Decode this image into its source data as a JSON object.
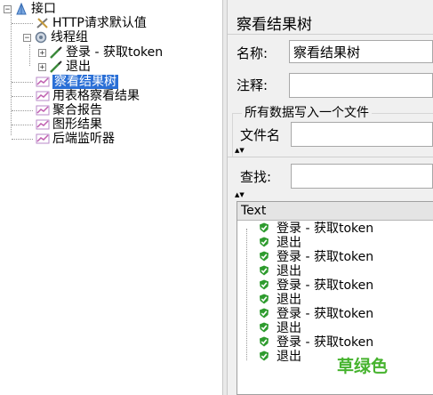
{
  "tree": {
    "root": "接口",
    "http_defaults": "HTTP请求默认值",
    "thread_group": "线程组",
    "login": "登录 - 获取token",
    "logout": "退出",
    "listeners": [
      "察看结果树",
      "用表格察看结果",
      "聚合报告",
      "图形结果",
      "后端监听器"
    ]
  },
  "panel": {
    "title": "察看结果树",
    "name_label": "名称:",
    "name_value": "察看结果树",
    "comment_label": "注释:",
    "comment_value": "",
    "group_legend": "所有数据写入一个文件",
    "filename_label": "文件名",
    "filename_value": "",
    "search_label": "查找:",
    "search_value": "",
    "results_header": "Text",
    "results": [
      "登录 - 获取token",
      "退出",
      "登录 - 获取token",
      "退出",
      "登录 - 获取token",
      "退出",
      "登录 - 获取token",
      "退出",
      "登录 - 获取token",
      "退出"
    ],
    "annotation": "草绿色"
  },
  "colors": {
    "selection": "#2a6fd6",
    "success": "#2e9b2e",
    "annotation": "#46b32e"
  }
}
